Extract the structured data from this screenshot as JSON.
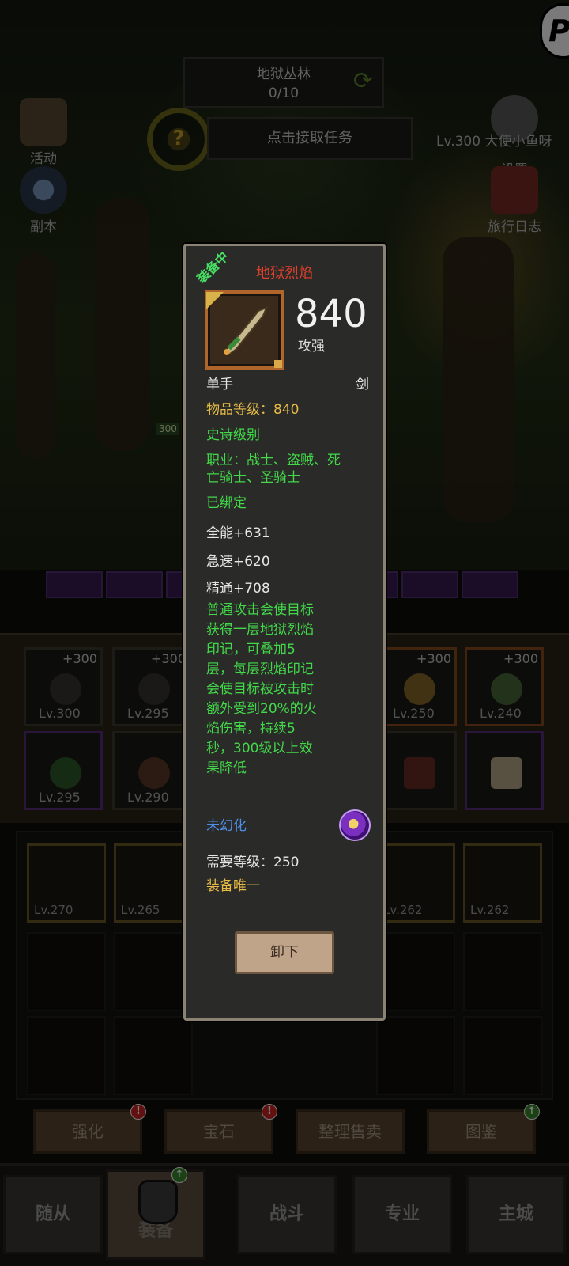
{
  "hud": {
    "zone_name": "地狱丛林",
    "zone_progress": "0/10",
    "task_prompt": "点击接取任务",
    "task_help_icon": "?",
    "left_buttons": [
      {
        "label": "活动",
        "icon": "scroll-icon"
      },
      {
        "label": "副本",
        "icon": "portal-icon"
      }
    ],
    "right_buttons": [
      {
        "label": "设置",
        "icon": "gear-icon"
      },
      {
        "label": "旅行日志",
        "icon": "book-icon"
      }
    ],
    "player_level": "Lv.300 大使小鱼呀",
    "hp_tag": "300",
    "corner_logo": "P"
  },
  "equipment_grid": [
    {
      "level": "Lv.300",
      "plus": "+300",
      "rarity": "normal"
    },
    {
      "level": "Lv.295",
      "plus": "+300",
      "rarity": "normal"
    },
    {
      "level": "Lv.250",
      "plus": "+300",
      "rarity": "orange"
    },
    {
      "level": "Lv.240",
      "plus": "+300",
      "rarity": "orange"
    },
    {
      "level": "Lv.295",
      "plus": "",
      "rarity": "purple"
    },
    {
      "level": "Lv.290",
      "plus": "",
      "rarity": "normal"
    },
    {
      "level": "",
      "plus": "",
      "rarity": "normal"
    },
    {
      "level": "",
      "plus": "",
      "rarity": "purple"
    }
  ],
  "bag": [
    {
      "level": "Lv.270"
    },
    {
      "level": "Lv.265"
    },
    {
      "level": "Lv.262"
    },
    {
      "level": "Lv.262"
    }
  ],
  "actions": {
    "enhance": "强化",
    "gem": "宝石",
    "sort_sell": "整理售卖",
    "codex": "图鉴",
    "badge_alert": "!",
    "badge_up": "↑"
  },
  "nav": {
    "followers": "随从",
    "equipment": "装备",
    "battle": "战斗",
    "profession": "专业",
    "main_city": "主城"
  },
  "item": {
    "equipped_tag": "装备中",
    "name": "地狱烈焰",
    "power": "840",
    "power_label": "攻强",
    "hand": "单手",
    "weapon_type": "剑",
    "item_level": "物品等级：840",
    "quality": "史诗级别",
    "classes_line1": "职业：战士、盗贼、死",
    "classes_line2": "亡骑士、圣骑士",
    "bound": "已绑定",
    "stat_1": "全能+631",
    "stat_2": "急速+620",
    "stat_3": "精通+708",
    "desc_lines": [
      "普通攻击会使目标",
      "获得一层地狱烈焰",
      "印记，可叠加5",
      "层，每层烈焰印记",
      "会使目标被攻击时",
      "额外受到20%的火",
      "焰伤害，持续5",
      "秒，300级以上效",
      "果降低"
    ],
    "transmog": "未幻化",
    "required_level": "需要等级：250",
    "unique": "装备唯一",
    "unequip_button": "卸下"
  },
  "colors": {
    "item_name": "#e0402c",
    "epic_green": "#43d84a",
    "gold_text": "#e6bb46",
    "transmog_blue": "#4d8fe8",
    "panel_border": "#8a8373"
  }
}
